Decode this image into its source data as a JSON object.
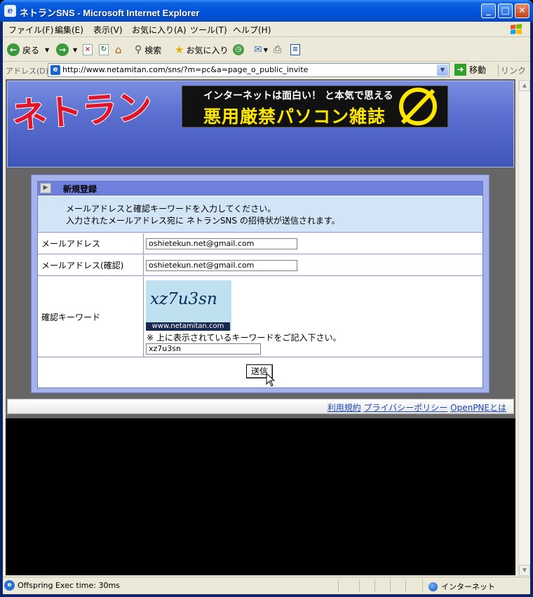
{
  "window": {
    "title": "ネトランSNS - Microsoft Internet Explorer",
    "minimize": "_",
    "maximize": "□",
    "close": "✕"
  },
  "menubar": [
    "ファイル(F)",
    "編集(E)",
    "表示(V)",
    "お気に入り(A)",
    "ツール(T)",
    "ヘルプ(H)"
  ],
  "toolbar": {
    "back_label": "戻る",
    "search_label": "検索",
    "favorites_label": "お気に入り"
  },
  "addressbar": {
    "label": "アドレス(D)",
    "url": "http://www.netamitan.com/sns/?m=pc&a=page_o_public_invite",
    "go_label": "移動",
    "links_label": "リンク"
  },
  "header": {
    "logo_text": "ネトラン",
    "banner_line1": "インターネットは面白い！ と本気で思える",
    "banner_line2": "悪用厳禁パソコン雑誌"
  },
  "form": {
    "title": "新規登録",
    "intro_line1": "メールアドレスと確認キーワードを入力してください。",
    "intro_line2": "入力されたメールアドレス宛に ネトランSNS の招待状が送信されます。",
    "email_label": "メールアドレス",
    "email_value": "oshietekun.net@gmail.com",
    "email_confirm_label": "メールアドレス(確認)",
    "email_confirm_value": "oshietekun.net@gmail.com",
    "keyword_label": "確認キーワード",
    "captcha_text": "xz7u3sn",
    "captcha_url": "www.netamitan.com",
    "captcha_note": "※ 上に表示されているキーワードをご記入下さい。",
    "keyword_value": "xz7u3sn",
    "submit_label": "送信"
  },
  "footer": {
    "terms": "利用規約",
    "privacy": "プライバシーポリシー",
    "about": "OpenPNEとは"
  },
  "statusbar": {
    "text": "Offspring Exec time: 30ms",
    "zone": "インターネット"
  },
  "colors": {
    "titlebar": "#0052d8",
    "header_blue": "#5a6fd0",
    "form_head": "#6f7fdc",
    "intro_bg": "#d2e5f7",
    "link": "#1d47b5"
  }
}
